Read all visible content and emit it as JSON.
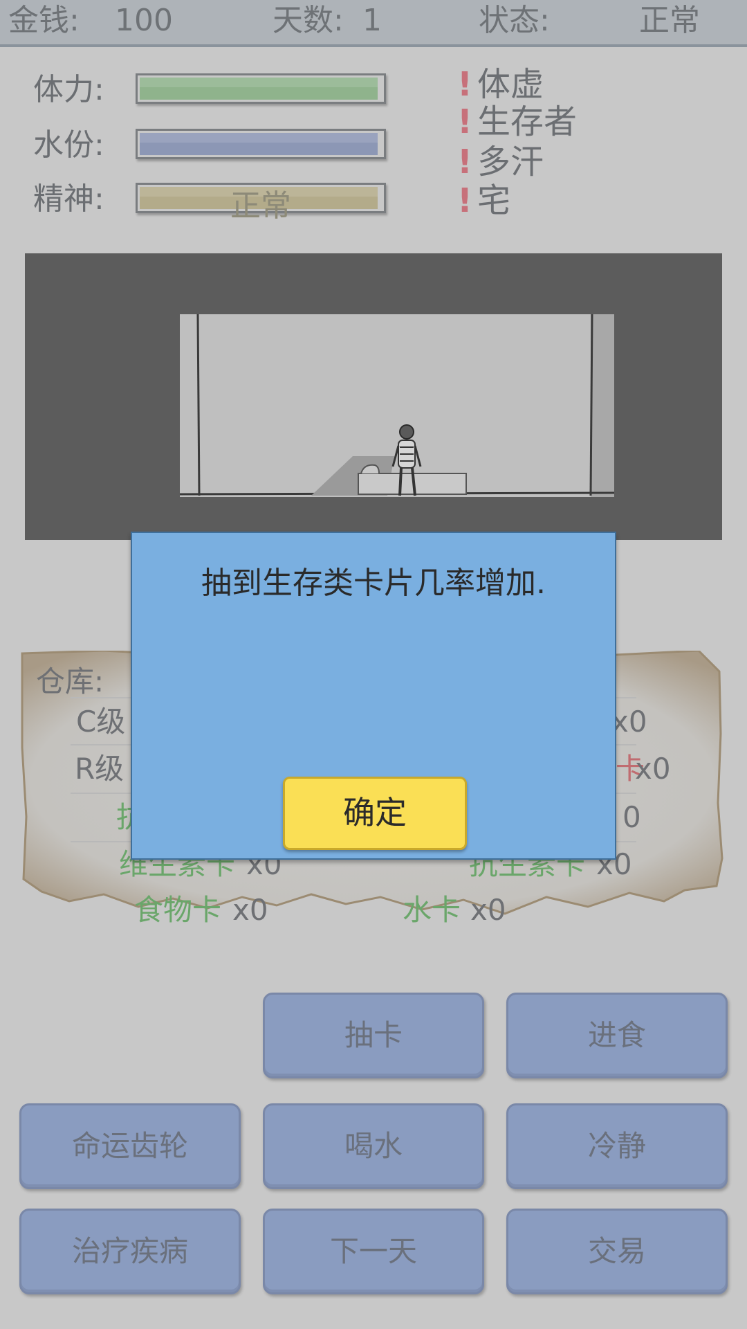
{
  "topbar": {
    "money_label": "金钱:",
    "money_value": "100",
    "days_label": "天数:",
    "days_value": "1",
    "status_label": "状态:",
    "status_value": "正常"
  },
  "stats": {
    "stamina_label": "体力:",
    "stamina_level": 1.0,
    "water_label": "水份:",
    "water_level": 1.0,
    "spirit_label": "精神:",
    "spirit_level": 1.0,
    "spirit_text": "正常"
  },
  "traits": [
    "体虚",
    "生存者",
    "多汗",
    "宅"
  ],
  "storage": {
    "title": "仓库:",
    "c_label": "C级",
    "c_count": "x0",
    "r_label": "R级",
    "r_right_partial": "卡",
    "r_count": "x0",
    "row3_left_partial": "抗",
    "row3_right_partial": "0",
    "vitamin_left_visible": "维生素卡",
    "vitamin_left_count": "x0",
    "antibiotic_label": "抗生素卡",
    "antibiotic_count": "x0",
    "food_label": "食物卡",
    "food_count": "x0",
    "water_label": "水卡",
    "water_count": "x0"
  },
  "buttons": {
    "draw_card": "抽卡",
    "eat": "进食",
    "fate_wheel": "命运齿轮",
    "drink": "喝水",
    "calm": "冷静",
    "heal": "治疗疾病",
    "next_day": "下一天",
    "trade": "交易"
  },
  "modal": {
    "message": "抽到生存类卡片几率增加.",
    "confirm": "确定"
  },
  "colors": {
    "stamina_bar": "#8fb38c",
    "water_bar": "#8c97b5",
    "spirit_bar": "#b3ab8a",
    "trait_mark": "#c7707a",
    "modal_bg": "#7aafe0",
    "confirm_bg": "#fadf55",
    "button_bg": "#8a9cc0"
  }
}
